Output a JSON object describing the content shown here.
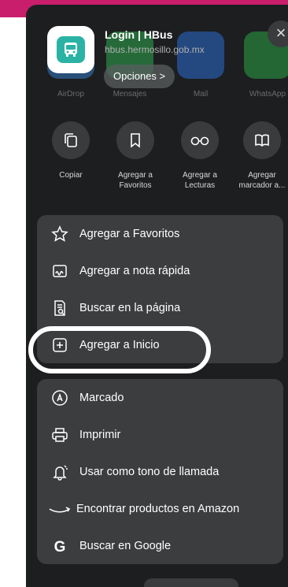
{
  "header": {
    "title": "Login | HBus",
    "url": "hbus.hermosillo.gob.mx",
    "options_label": "Opciones >",
    "close_glyph": "×"
  },
  "share_targets": [
    {
      "label": "AirDrop",
      "color": "#3a8ee6"
    },
    {
      "label": "Mensajes",
      "color": "#32c759"
    },
    {
      "label": "Mail",
      "color": "#2f7cf6"
    },
    {
      "label": "WhatsApp",
      "color": "#2fbe4d"
    }
  ],
  "actions": [
    {
      "label": "Copiar"
    },
    {
      "label": "Agregar a Favoritos"
    },
    {
      "label": "Agregar a Lecturas"
    },
    {
      "label": "Agregar marcador a..."
    }
  ],
  "group1": [
    {
      "label": "Agregar a Favoritos",
      "icon": "star-icon"
    },
    {
      "label": "Agregar a nota rápida",
      "icon": "quick-note-icon"
    },
    {
      "label": "Buscar en la página",
      "icon": "find-in-page-icon"
    },
    {
      "label": "Agregar a Inicio",
      "icon": "add-square-icon"
    }
  ],
  "group2": [
    {
      "label": "Marcado",
      "icon": "markup-icon"
    },
    {
      "label": "Imprimir",
      "icon": "printer-icon"
    },
    {
      "label": "Usar como tono de llamada",
      "icon": "bell-icon"
    },
    {
      "label": "Encontrar productos en Amazon",
      "icon": "amazon-icon"
    },
    {
      "label": "Buscar en Google",
      "icon": "google-icon"
    }
  ],
  "colors": {
    "sheet": "#1d1e20",
    "group": "#3c3d3f",
    "accent_pink": "#c81e6c",
    "app_teal": "#2ab3a5"
  }
}
